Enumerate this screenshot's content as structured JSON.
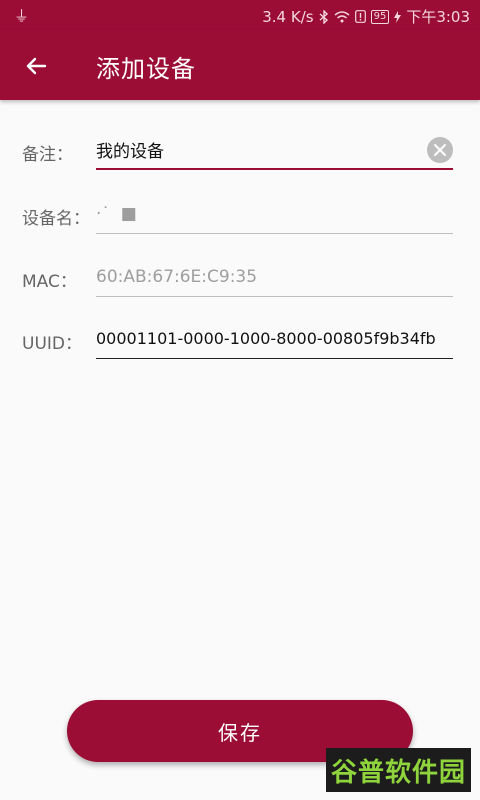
{
  "status_bar": {
    "speed": "3.4 K/s",
    "battery": "95",
    "time": "下午3:03"
  },
  "app_bar": {
    "title": "添加设备"
  },
  "form": {
    "remark": {
      "label": "备注：",
      "value": "我的设备"
    },
    "device_name": {
      "label": "设备名：",
      "value": "·˙  ■"
    },
    "mac": {
      "label": "MAC：",
      "value": "60:AB:67:6E:C9:35"
    },
    "uuid": {
      "label": "UUID：",
      "value": "00001101-0000-1000-8000-00805f9b34fb"
    }
  },
  "save_button": {
    "label": "保存"
  },
  "watermark": {
    "text": "谷普软件园"
  },
  "colors": {
    "brand": "#9c0d36",
    "background": "#fafafa",
    "watermark_bg": "#1c1c1c",
    "watermark_text": "#8fd43c"
  }
}
